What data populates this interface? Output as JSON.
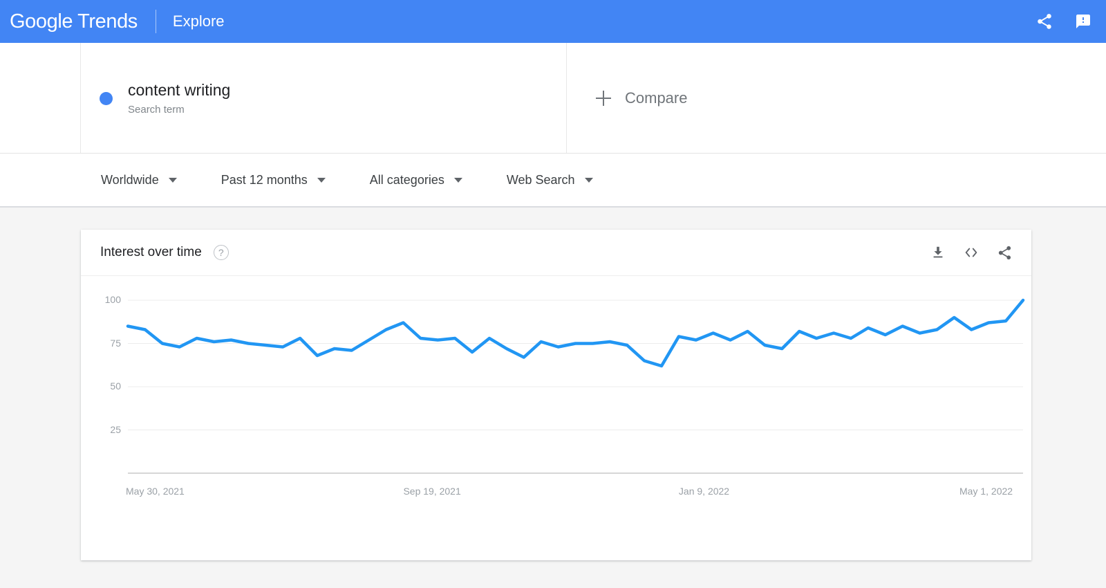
{
  "appbar": {
    "brand_google": "Google",
    "brand_trends": "Trends",
    "explore_label": "Explore",
    "share_icon": "share-icon",
    "feedback_icon": "feedback-icon",
    "background_color": "#4285f4"
  },
  "query": {
    "term": "content writing",
    "term_type": "Search term",
    "dot_color": "#4285f4",
    "compare_label": "Compare",
    "add_icon": "plus-icon"
  },
  "filters": [
    {
      "label": "Worldwide",
      "name": "location"
    },
    {
      "label": "Past 12 months",
      "name": "time-range"
    },
    {
      "label": "All categories",
      "name": "category"
    },
    {
      "label": "Web Search",
      "name": "search-type"
    }
  ],
  "card": {
    "title": "Interest over time",
    "help_icon": "help-icon",
    "help_glyph": "?",
    "actions": [
      {
        "name": "download-csv-button",
        "icon": "download-icon"
      },
      {
        "name": "embed-button",
        "icon": "embed-code-icon"
      },
      {
        "name": "share-chart-button",
        "icon": "share-icon"
      }
    ]
  },
  "chart_data": {
    "type": "line",
    "title": "Interest over time",
    "xlabel": "",
    "ylabel": "",
    "ylim": [
      0,
      108
    ],
    "yticks": [
      100,
      75,
      50,
      25
    ],
    "grid": true,
    "legend": false,
    "line_color": "#2196f3",
    "xtick_labels": [
      "May 30, 2021",
      "Sep 19, 2021",
      "Jan 9, 2022",
      "May 1, 2022"
    ],
    "xtick_positions": [
      0,
      16,
      32,
      48
    ],
    "series": [
      {
        "name": "content writing",
        "color": "#2196f3",
        "values": [
          85,
          83,
          75,
          73,
          78,
          76,
          77,
          75,
          74,
          73,
          78,
          68,
          72,
          71,
          77,
          83,
          87,
          78,
          77,
          78,
          70,
          78,
          72,
          67,
          76,
          73,
          75,
          75,
          76,
          74,
          65,
          62,
          79,
          77,
          81,
          77,
          82,
          74,
          72,
          82,
          78,
          81,
          78,
          84,
          80,
          85,
          81,
          83,
          90,
          83,
          87,
          88,
          100
        ]
      }
    ]
  }
}
